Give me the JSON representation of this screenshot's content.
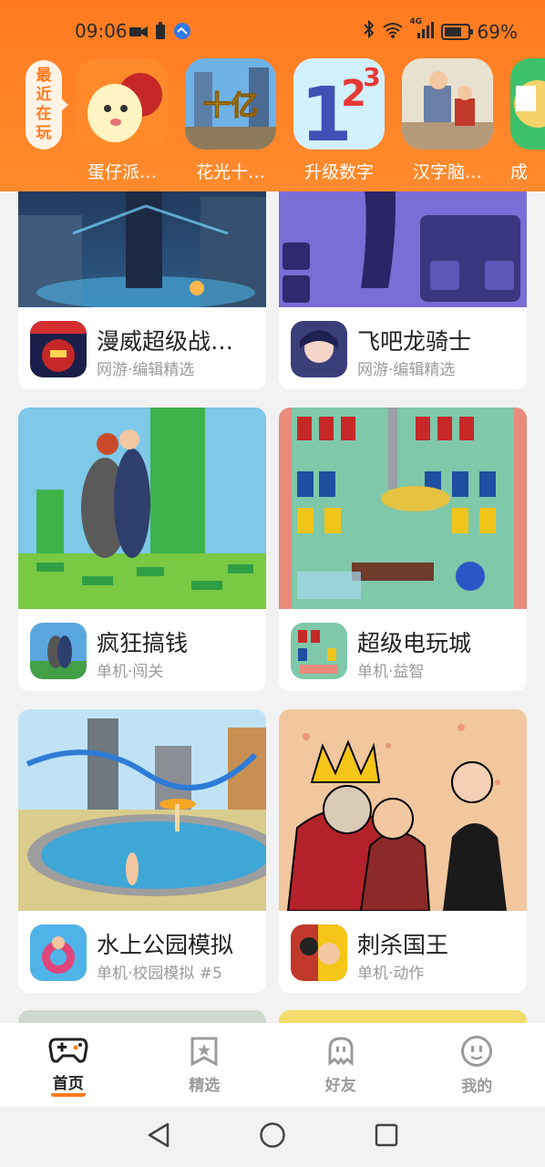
{
  "status_bar": {
    "time": "09:06",
    "network": "4G",
    "battery_percent": "69%"
  },
  "recent": {
    "label_chars": [
      "最",
      "近",
      "在",
      "玩"
    ],
    "games": [
      {
        "name": "蛋仔派…",
        "icon": "eggy-party-icon"
      },
      {
        "name": "花光十…",
        "icon": "spend-billion-icon"
      },
      {
        "name": "升级数字",
        "icon": "upgrade-number-icon"
      },
      {
        "name": "汉字脑…",
        "icon": "chinese-brain-icon"
      },
      {
        "name": "成",
        "icon": "partial-game-icon"
      }
    ]
  },
  "feed": {
    "cards": [
      {
        "title": "漫威超级战…",
        "subtitle": "网游·编辑精选",
        "icon": "marvel-icon"
      },
      {
        "title": "飞吧龙骑士",
        "subtitle": "网游·编辑精选",
        "icon": "dragon-knight-icon"
      },
      {
        "title": "疯狂搞钱",
        "subtitle": "单机·闯关",
        "icon": "crazy-money-icon"
      },
      {
        "title": "超级电玩城",
        "subtitle": "单机·益智",
        "icon": "arcade-icon"
      },
      {
        "title": "水上公园模拟",
        "subtitle": "单机·校园模拟 #5",
        "icon": "water-park-icon"
      },
      {
        "title": "刺杀国王",
        "subtitle": "单机·动作",
        "icon": "assassinate-king-icon"
      }
    ]
  },
  "bottom_nav": {
    "items": [
      {
        "label": "首页",
        "icon": "gamepad-icon",
        "active": true
      },
      {
        "label": "精选",
        "icon": "star-bookmark-icon",
        "active": false
      },
      {
        "label": "好友",
        "icon": "ghost-icon",
        "active": false
      },
      {
        "label": "我的",
        "icon": "smiley-icon",
        "active": false
      }
    ]
  },
  "colors": {
    "brand": "#ff7a1f",
    "background": "#f2f2f2",
    "text_primary": "#222222",
    "text_secondary": "#9a9a9a"
  }
}
